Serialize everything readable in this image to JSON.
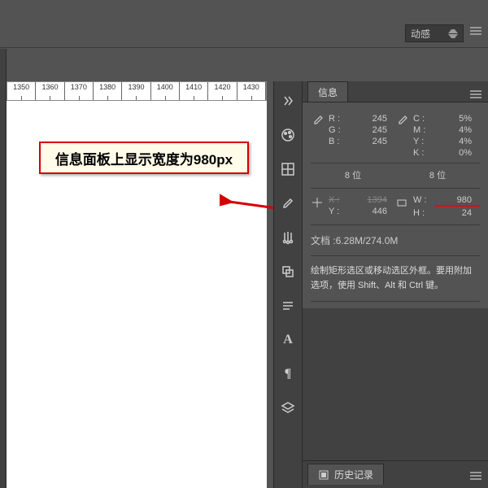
{
  "topbar": {
    "dropdown_label": "动感"
  },
  "ruler": {
    "ticks": [
      "1350",
      "1360",
      "1370",
      "1380",
      "1390",
      "1400",
      "1410",
      "1420",
      "1430"
    ]
  },
  "callout": {
    "text": "信息面板上显示宽度为980px"
  },
  "info_panel": {
    "title": "信息",
    "rgb": {
      "R": "245",
      "G": "245",
      "B": "245"
    },
    "cmyk": {
      "C": "5%",
      "M": "4%",
      "Y": "4%",
      "K": "0%"
    },
    "bits_left": "8 位",
    "bits_right": "8 位",
    "X": "1394",
    "Y": "446",
    "W": "980",
    "H": "24",
    "doc": "文档 :6.28M/274.0M",
    "hint": "绘制矩形选区或移动选区外框。要用附加选项，使用 Shift、Alt 和 Ctrl 键。"
  },
  "history_panel": {
    "title": "历史记录"
  },
  "chart_data": null
}
